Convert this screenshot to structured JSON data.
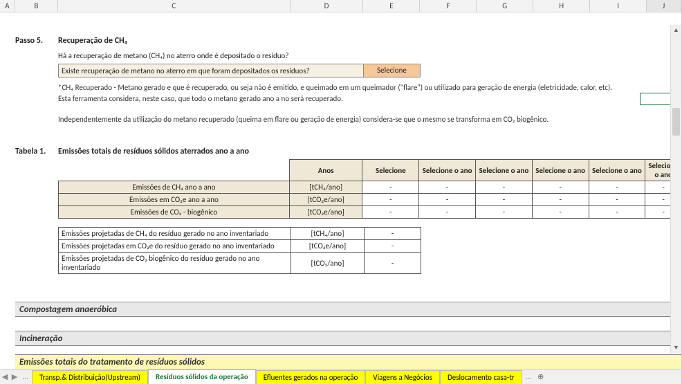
{
  "columns": [
    "A",
    "B",
    "C",
    "D",
    "E",
    "F",
    "G",
    "H",
    "I",
    "J"
  ],
  "step": {
    "label": "Passo 5.",
    "title": "Recuperação de CH₄",
    "question_prompt": "Há a recuperação de metano (CH₄) no aterro onde é depositado o resíduo?",
    "question_cell": "Existe recuperação de metano no aterro em que foram depositados os resíduos?",
    "selection_value": "Selecione",
    "note1": "*CH₄ Recuperado - Metano gerado e que é recuperado, ou seja não é emitido, e queimado em um queimador (\"flare\") ou utilizado para geração de energia (eletricidade, calor, etc).",
    "note2": "Esta ferramenta considera, neste caso, que todo o metano gerado ano a no será recuperado.",
    "note3": "Independentemente da utilização do metano recuperado (queima em flare ou geração de energia) considera-se que o mesmo se transforma em CO₂ biogênico."
  },
  "table1": {
    "label": "Tabela 1.",
    "title": "Emissões totais de resíduos sólidos aterrados ano a ano",
    "headers": {
      "anos": "Anos",
      "sel": "Selecione",
      "selano": "Selecione o ano"
    },
    "rows": [
      {
        "label": "Emissões de CH₄  ano a ano",
        "unit": "[tCH₄/ano]",
        "vals": [
          "-",
          "-",
          "-",
          "-",
          "-",
          "-"
        ]
      },
      {
        "label": "Emissões em CO₂e ano a ano",
        "unit": "[tCO₂e/ano]",
        "vals": [
          "-",
          "-",
          "-",
          "-",
          "-",
          "-"
        ]
      },
      {
        "label": "Emissões de CO₂ - biogênico",
        "unit": "[tCO₂e/ano]",
        "vals": [
          "-",
          "-",
          "-",
          "-",
          "-",
          "-"
        ]
      }
    ]
  },
  "table2": {
    "rows": [
      {
        "label": "Emissões projetadas de CH₄ do resíduo gerado no ano inventariado",
        "unit": "[tCH₄/ano]",
        "val": "-"
      },
      {
        "label": "Emissões projetadas em CO₂e do resíduo gerado no ano inventariado",
        "unit": "[tCO₂e/ano]",
        "val": "-"
      },
      {
        "label": "Emissões projetadas de CO₂ biogênico do resíduo gerado no ano inventariado",
        "unit": "[tCO₂/ano]",
        "val": "-"
      }
    ]
  },
  "sections": {
    "bar1": "Compostagem anaeróbica",
    "bar2": "Incineração",
    "bar3": "Emissões totais do tratamento de resíduos sólidos"
  },
  "tabs": {
    "nav_prev": "◀",
    "nav_next": "▶",
    "items": [
      {
        "label": "Transp.& Distribuição(Upstream)",
        "style": "yellow"
      },
      {
        "label": "Resíduos sólidos da operação",
        "style": "active"
      },
      {
        "label": "Efluentes gerados na operação",
        "style": "yellow"
      },
      {
        "label": "Viagens a Negócios",
        "style": "yellow"
      },
      {
        "label": "Deslocamento casa-tr",
        "style": "yellow"
      }
    ],
    "more": "…",
    "add": "⊕"
  },
  "scroll": {
    "up": "▲",
    "down": "▼"
  }
}
